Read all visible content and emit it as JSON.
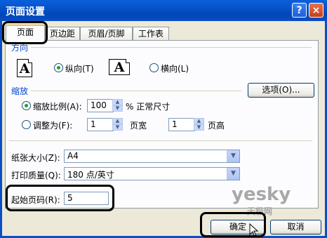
{
  "window": {
    "title": "页面设置",
    "help_label": "?",
    "close_label": "×"
  },
  "tabs": [
    {
      "label": "页面",
      "active": true
    },
    {
      "label": "页边距"
    },
    {
      "label": "页眉/页脚"
    },
    {
      "label": "工作表"
    }
  ],
  "orientation": {
    "group_label": "方向",
    "portrait_label": "纵向(T)",
    "landscape_label": "横向(L)",
    "icon_glyph": "A",
    "selected": "portrait"
  },
  "scaling": {
    "group_label": "缩放",
    "options_button": "选项(O)...",
    "adjust_to_label": "缩放比例(A):",
    "adjust_value": "100",
    "adjust_suffix": "% 正常尺寸",
    "fit_to_label": "调整为(F):",
    "fit_wide_value": "1",
    "fit_wide_label": "页宽",
    "fit_tall_value": "1",
    "fit_tall_label": "页高",
    "selected": "adjust"
  },
  "paper_size": {
    "label": "纸张大小(Z):",
    "value": "A4"
  },
  "print_quality": {
    "label": "打印质量(Q):",
    "value": "180 点/英寸"
  },
  "first_page_number": {
    "label": "起始页码(R):",
    "value": "5"
  },
  "buttons": {
    "ok": "确定",
    "cancel": "取消"
  },
  "watermark": {
    "brand": "yesky",
    "sub": "天极网"
  }
}
